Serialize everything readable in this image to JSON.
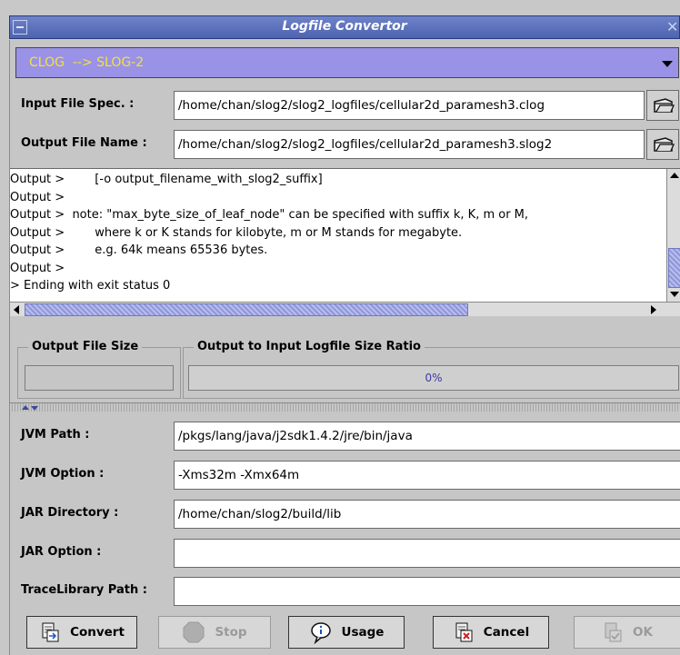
{
  "window": {
    "title": "Logfile Convertor"
  },
  "converter_combo": {
    "selected": "CLOG  --> SLOG-2"
  },
  "files": {
    "input_label": "Input File Spec. :",
    "input_value": "/home/chan/slog2/slog2_logfiles/cellular2d_paramesh3.clog",
    "output_label": "Output File Name :",
    "output_value": "/home/chan/slog2/slog2_logfiles/cellular2d_paramesh3.slog2"
  },
  "console": {
    "lines": [
      "Output >        [-o output_filename_with_slog2_suffix]",
      "Output >",
      "Output >  note: \"max_byte_size_of_leaf_node\" can be specified with suffix k, K, m or M,",
      "Output >        where k or K stands for kilobyte, m or M stands for megabyte.",
      "Output >        e.g. 64k means 65536 bytes.",
      "Output >",
      "> Ending with exit status 0"
    ]
  },
  "status": {
    "size_title": "Output File Size",
    "size_value": "",
    "ratio_title": "Output to Input Logfile Size Ratio",
    "ratio_text": "0%",
    "ratio_fraction": 0
  },
  "settings": {
    "jvm_path_label": "JVM Path :",
    "jvm_path_value": "/pkgs/lang/java/j2sdk1.4.2/jre/bin/java",
    "jvm_option_label": "JVM Option :",
    "jvm_option_value": "-Xms32m -Xmx64m",
    "jar_dir_label": "JAR Directory :",
    "jar_dir_value": "/home/chan/slog2/build/lib",
    "jar_option_label": "JAR Option :",
    "jar_option_value": "",
    "trace_lib_label": "TraceLibrary Path :",
    "trace_lib_value": ""
  },
  "buttons": {
    "convert": "Convert",
    "stop": "Stop",
    "usage": "Usage",
    "cancel": "Cancel",
    "ok": "OK"
  },
  "colors": {
    "titlebar": "#5a6fbe",
    "combo_bg": "#9a92e6",
    "combo_text": "#f2e33a",
    "scroll_thumb": "#8f97d8"
  }
}
